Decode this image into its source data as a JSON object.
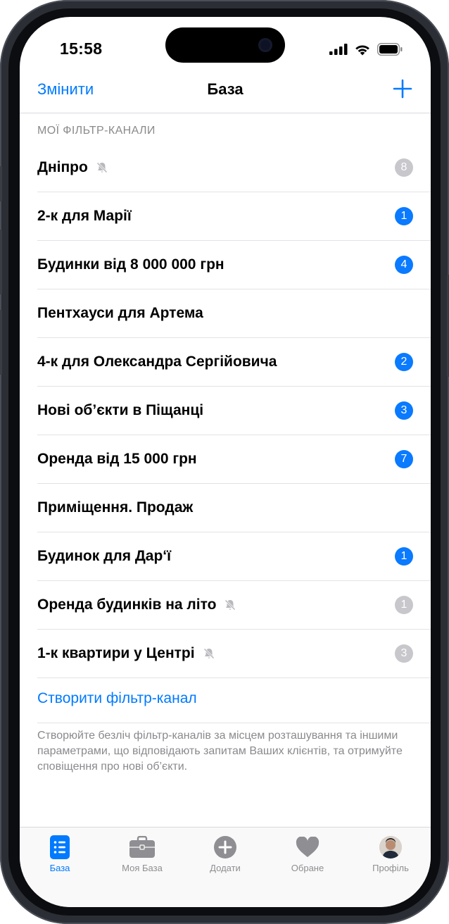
{
  "status": {
    "time": "15:58"
  },
  "nav": {
    "edit_label": "Змінити",
    "title": "База"
  },
  "section_header": "МОЇ ФІЛЬТР-КАНАЛИ",
  "channels": [
    {
      "label": "Дніпро",
      "muted": true,
      "badge": "8",
      "badge_style": "gray"
    },
    {
      "label": "2-к для Марії",
      "muted": false,
      "badge": "1",
      "badge_style": "blue"
    },
    {
      "label": "Будинки від 8 000 000 грн",
      "muted": false,
      "badge": "4",
      "badge_style": "blue"
    },
    {
      "label": "Пентхауси для Артема",
      "muted": false,
      "badge": "",
      "badge_style": ""
    },
    {
      "label": "4-к для Олександра Сергійовича",
      "muted": false,
      "badge": "2",
      "badge_style": "blue"
    },
    {
      "label": "Нові об’єкти в Піщанці",
      "muted": false,
      "badge": "3",
      "badge_style": "blue"
    },
    {
      "label": "Оренда від 15 000 грн",
      "muted": false,
      "badge": "7",
      "badge_style": "blue"
    },
    {
      "label": "Приміщення. Продаж",
      "muted": false,
      "badge": "",
      "badge_style": ""
    },
    {
      "label": "Будинок для Дар‘ї",
      "muted": false,
      "badge": "1",
      "badge_style": "blue"
    },
    {
      "label": "Оренда будинків на літо",
      "muted": true,
      "badge": "1",
      "badge_style": "gray"
    },
    {
      "label": "1-к квартири у Центрі",
      "muted": true,
      "badge": "3",
      "badge_style": "gray"
    }
  ],
  "create_label": "Створити фільтр-канал",
  "footer": "Створюйте безліч фільтр-каналів за місцем розташування та іншими параметрами, що відповідають запитам Ваших клієнтів, та отримуйте сповіщення про нові об’єкти.",
  "tabs": [
    {
      "label": "База",
      "icon": "list-icon",
      "active": true
    },
    {
      "label": "Моя База",
      "icon": "briefcase-icon",
      "active": false
    },
    {
      "label": "Додати",
      "icon": "plus-circle-icon",
      "active": false
    },
    {
      "label": "Обране",
      "icon": "heart-icon",
      "active": false
    },
    {
      "label": "Профіль",
      "icon": "avatar",
      "active": false
    }
  ],
  "colors": {
    "accent": "#007aff",
    "badge_blue": "#0a7aff",
    "badge_gray": "#c7c7cc",
    "secondary_text": "#8a8a8e"
  }
}
